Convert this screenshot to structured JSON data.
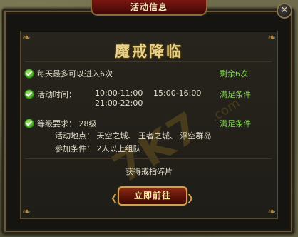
{
  "window": {
    "title": "活动信息",
    "close_symbol": "✕"
  },
  "event": {
    "title": "魔戒降临"
  },
  "rows": [
    {
      "text": "每天最多可以进入6次",
      "status": "剩余6次"
    },
    {
      "label": "活动时间：",
      "time1": "10:00-11:00",
      "time2": "15:00-16:00",
      "time3": "21:00-22:00",
      "status": "满足条件"
    },
    {
      "text": "等级要求： 28级",
      "status": "满足条件",
      "location": "活动地点： 天空之城、 王者之城、 浮空群岛",
      "condition": "参加条件： 2人以上组队"
    }
  ],
  "reward": "获得戒指碎片",
  "go_button": "立即前往",
  "watermark": {
    "main": "7K7",
    "sub": ".com"
  }
}
